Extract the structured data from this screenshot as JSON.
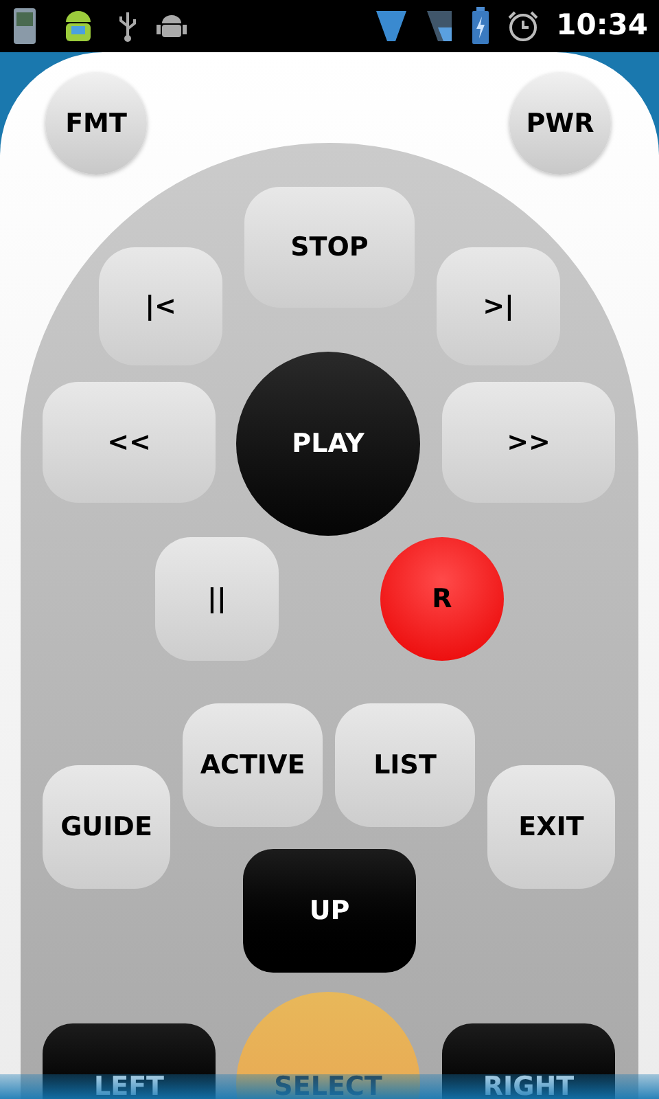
{
  "status_bar": {
    "time": "10:34"
  },
  "buttons": [
    {
      "label": "FMT",
      "kind": "light-round"
    },
    {
      "label": "PWR",
      "kind": "light-round"
    },
    {
      "label": "STOP",
      "kind": "light-rect"
    },
    {
      "label": "|<",
      "kind": "light-rect"
    },
    {
      "label": ">|",
      "kind": "light-rect"
    },
    {
      "label": "<<",
      "kind": "light-rect"
    },
    {
      "label": "PLAY",
      "kind": "dark-round"
    },
    {
      "label": ">>",
      "kind": "light-rect"
    },
    {
      "label": "||",
      "kind": "light-rect"
    },
    {
      "label": "R",
      "kind": "red-round"
    },
    {
      "label": "ACTIVE",
      "kind": "light-rect"
    },
    {
      "label": "LIST",
      "kind": "light-rect"
    },
    {
      "label": "GUIDE",
      "kind": "light-rect"
    },
    {
      "label": "EXIT",
      "kind": "light-rect"
    },
    {
      "label": "UP",
      "kind": "dark-rect"
    },
    {
      "label": "LEFT",
      "kind": "dark-rect"
    },
    {
      "label": "SELECT",
      "kind": "orange-round"
    },
    {
      "label": "RIGHT",
      "kind": "dark-rect"
    }
  ]
}
